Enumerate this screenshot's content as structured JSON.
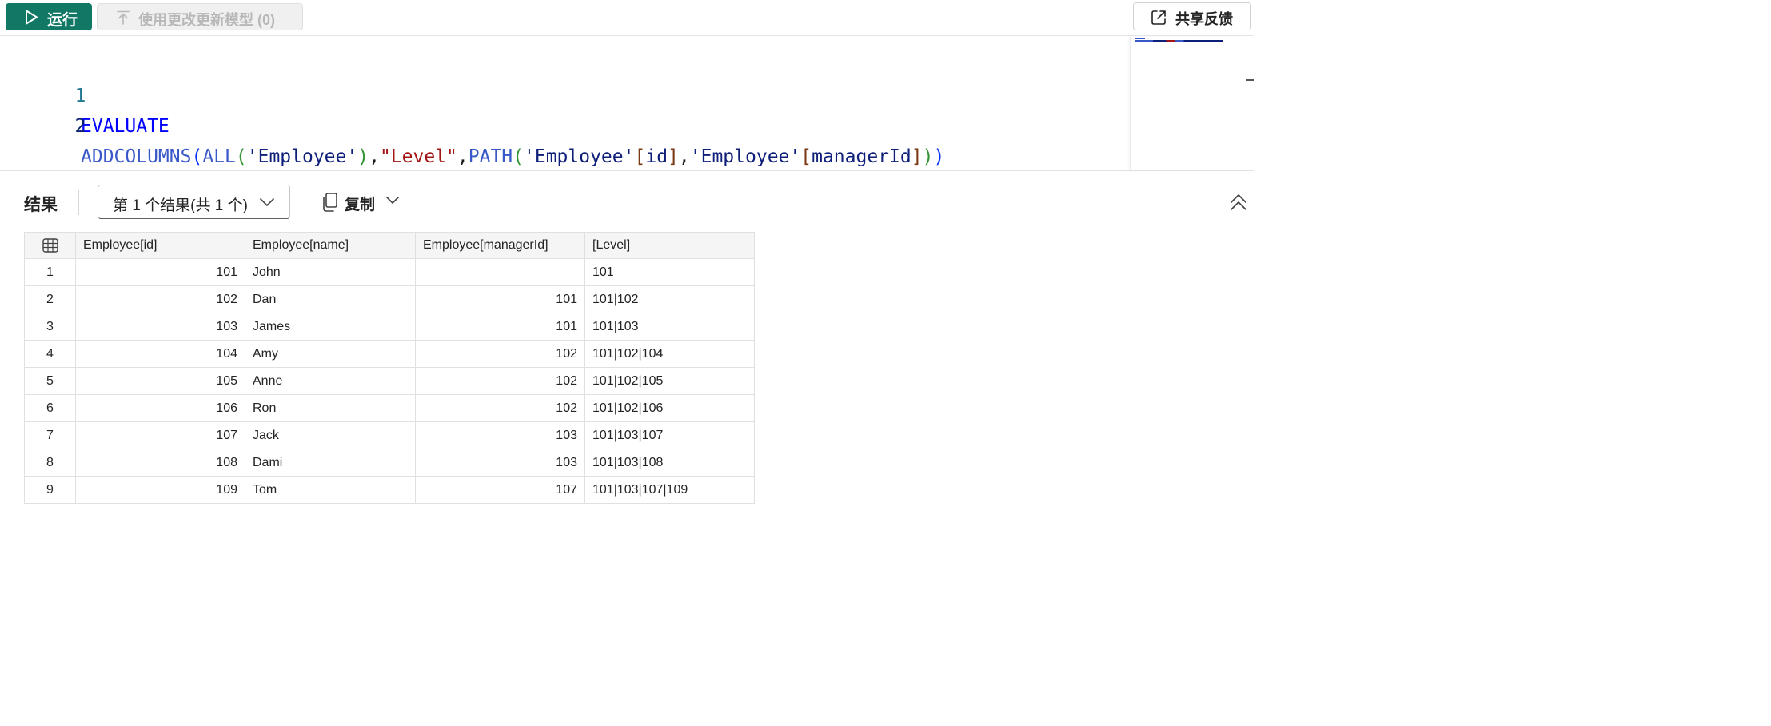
{
  "toolbar": {
    "run_label": "运行",
    "update_label": "使用更改更新模型 (0)",
    "feedback_label": "共享反馈"
  },
  "editor": {
    "line_numbers": [
      "1",
      "2"
    ],
    "line1": {
      "keyword": "EVALUATE"
    },
    "line2": {
      "fn_addcolumns": "ADDCOLUMNS",
      "p1_open": "(",
      "fn_all": "ALL",
      "p2_open": "(",
      "table1": "'Employee'",
      "p2_close": ")",
      "comma1": ",",
      "level_str": "\"Level\"",
      "comma2": ",",
      "fn_path": "PATH",
      "p2b_open": "(",
      "table2": "'Employee'",
      "br1_open": "[",
      "col_id": "id",
      "br1_close": "]",
      "comma3": ",",
      "table3": "'Employee'",
      "br2_open": "[",
      "col_manager": "managerId",
      "br2_close": "]",
      "p2b_close": ")",
      "p1_close": ")"
    }
  },
  "results": {
    "title": "结果",
    "selector_label": "第 1 个结果(共 1 个)",
    "copy_label": "复制",
    "columns": [
      "Employee[id]",
      "Employee[name]",
      "Employee[managerId]",
      "[Level]"
    ],
    "rows": [
      {
        "n": "1",
        "id": "101",
        "name": "John",
        "manager": "",
        "level": "101"
      },
      {
        "n": "2",
        "id": "102",
        "name": "Dan",
        "manager": "101",
        "level": "101|102"
      },
      {
        "n": "3",
        "id": "103",
        "name": "James",
        "manager": "101",
        "level": "101|103"
      },
      {
        "n": "4",
        "id": "104",
        "name": "Amy",
        "manager": "102",
        "level": "101|102|104"
      },
      {
        "n": "5",
        "id": "105",
        "name": "Anne",
        "manager": "102",
        "level": "101|102|105"
      },
      {
        "n": "6",
        "id": "106",
        "name": "Ron",
        "manager": "102",
        "level": "101|102|106"
      },
      {
        "n": "7",
        "id": "107",
        "name": "Jack",
        "manager": "103",
        "level": "101|103|107"
      },
      {
        "n": "8",
        "id": "108",
        "name": "Dami",
        "manager": "103",
        "level": "101|103|108"
      },
      {
        "n": "9",
        "id": "109",
        "name": "Tom",
        "manager": "107",
        "level": "101|103|107|109"
      }
    ]
  },
  "icons": {
    "run": "play-icon",
    "update": "arrow-up-icon",
    "feedback": "share-icon",
    "selector": "chevron-down-icon",
    "copy": "copy-icon",
    "collapse": "double-chevron-up-icon",
    "grid_corner": "table-icon"
  },
  "colors": {
    "run_button": "#117865",
    "keyword": "#0000ff",
    "function": "#3a59c8",
    "string_literal": "#a31515",
    "table_ref": "#0e1f7a"
  }
}
